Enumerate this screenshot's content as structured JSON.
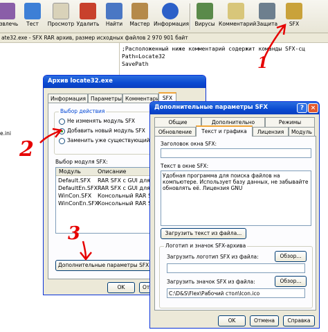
{
  "toolbar": {
    "buttons": [
      {
        "label": "Извлечь",
        "icon": "extract-icon"
      },
      {
        "label": "Тест",
        "icon": "test-icon"
      },
      {
        "label": "Просмотр",
        "icon": "view-icon"
      },
      {
        "label": "Удалить",
        "icon": "delete-icon"
      },
      {
        "label": "Найти",
        "icon": "find-icon"
      },
      {
        "label": "Мастер",
        "icon": "wizard-icon"
      },
      {
        "label": "Информация",
        "icon": "info-icon"
      },
      {
        "label": "Вирусы",
        "icon": "virus-icon"
      },
      {
        "label": "Комментарий",
        "icon": "comment-icon"
      },
      {
        "label": "Защита",
        "icon": "protect-icon"
      },
      {
        "label": "SFX",
        "icon": "sfx-icon"
      }
    ]
  },
  "infobar": {
    "text": "ate32.exe - SFX RAR архив, размер исходных файлов 2 970 901 байт"
  },
  "left_pane": {
    "item": "e.ini"
  },
  "comment_pane": {
    "lines": [
      ";Расположенный ниже комментарий содержит команды SFX-сц",
      "",
      "Path=Locate32",
      "SavePath"
    ]
  },
  "archive_window": {
    "title": "Архив locate32.exe",
    "tabs": [
      "Информация",
      "Параметры",
      "Комментарий",
      "SFX"
    ],
    "group_action": {
      "title": "Выбор действия",
      "options": [
        "Не изменять модуль SFX",
        "Добавить новый модуль SFX",
        "Заменить уже существующий модуль"
      ],
      "selected": 1
    },
    "module_group": {
      "title": "Выбор модуля SFX:",
      "columns": [
        "Модуль",
        "Описание"
      ],
      "rows": [
        {
          "module": "Default.SFX",
          "desc": "RAR SFX с GUI для Windows"
        },
        {
          "module": "DefaultEn.SFX",
          "desc": "RAR SFX с GUI для Windows"
        },
        {
          "module": "WinCon.SFX",
          "desc": "Консольный RAR SFX для Win"
        },
        {
          "module": "WinConEn.SFX",
          "desc": "Консольный RAR SFX для Win"
        }
      ]
    },
    "advanced_button": "Дополнительные параметры SFX...",
    "ok_button": "OK",
    "cancel_button": "Отмена"
  },
  "sfx_window": {
    "title": "Дополнительные параметры SFX",
    "tabs_row1": [
      "Общие",
      "Дополнительно",
      "Режимы"
    ],
    "tabs_row2": [
      "Обновление",
      "Текст и графика",
      "Лицензия",
      "Модуль"
    ],
    "title_label": "Заголовок окна SFX:",
    "title_value": "",
    "text_label": "Текст в окне SFX:",
    "text_value": "Удобная программа для поиска файлов на компьютере. Использует базу данных, не забывайте обновлять её. Лицензия GNU",
    "load_text_button": "Загрузить текст из файла...",
    "logo_group_title": "Логотип и значок SFX-архива",
    "logo_label": "Загрузить логотип SFX из файла:",
    "logo_value": "",
    "browse_logo": "Обзор...",
    "icon_label": "Загрузить значок SFX из файла:",
    "icon_value": "C:\\D&S\\Flex\\Рабочий стол\\Icon.ico",
    "browse_icon": "Обзор...",
    "ok_button": "OK",
    "cancel_button": "Отмена",
    "help_button": "Справка"
  },
  "annotations": {
    "one": "1",
    "two": "2",
    "three": "3"
  },
  "colors": {
    "title_bar": "#0a4ad1",
    "annotation": "#e60000",
    "tab_highlight": "#f0a437"
  }
}
